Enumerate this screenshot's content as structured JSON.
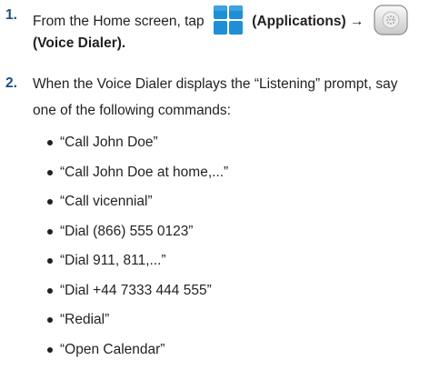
{
  "step1": {
    "number": "1.",
    "text_before": "From the Home screen, tap",
    "applications_label": "(Applications)",
    "arrow": "→",
    "voice_dialer_label": "(Voice Dialer)."
  },
  "step2": {
    "number": "2.",
    "line1": "When the Voice Dialer displays the “Listening” prompt, say",
    "line2": "one of the following commands:"
  },
  "commands": [
    "“Call John Doe”",
    "“Call John Doe at home,...”",
    "“Call vicennial”",
    "“Dial (866) 555 0123”",
    "“Dial 911, 811,...”",
    "“Dial +44 7333 444 555”",
    "“Redial”",
    "“Open Calendar”"
  ],
  "icons": {
    "applications": "grid-apps-icon",
    "voice_dialer": "microphone-dialer-icon"
  },
  "colors": {
    "apps_icon_blue": "#1e8fd6",
    "step_number": "#1a4f8b"
  }
}
